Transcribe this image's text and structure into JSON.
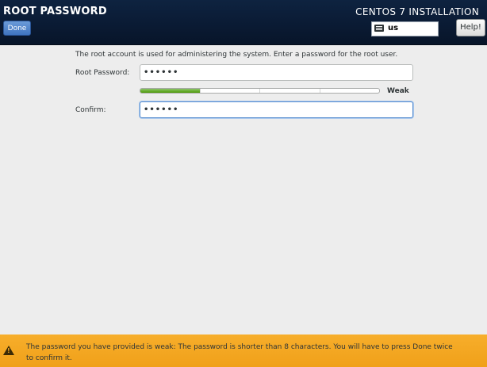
{
  "header": {
    "title": "ROOT PASSWORD",
    "done_label": "Done",
    "install_title": "CENTOS 7 INSTALLATION",
    "keyboard_layout": "us",
    "help_label": "Help!"
  },
  "form": {
    "description": "The root account is used for administering the system.  Enter a password for the root user.",
    "root_password_label": "Root Password:",
    "root_password_value": "••••••",
    "strength_label": "Weak",
    "strength_fraction": 0.25,
    "confirm_label": "Confirm:",
    "confirm_value": "••••••"
  },
  "warning": {
    "text_line1": "The password you have provided is weak: The password is shorter than 8 characters. You will have to press Done twice",
    "text_line2": "to confirm it."
  }
}
